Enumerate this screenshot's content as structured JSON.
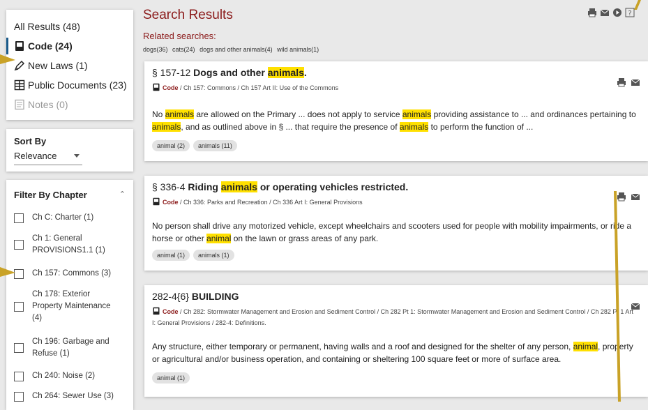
{
  "sidebar": {
    "results": [
      {
        "label": "All Results (48)",
        "icon": "none"
      },
      {
        "label": "Code (24)",
        "icon": "book-icon"
      },
      {
        "label": "New Laws (1)",
        "icon": "pen-icon"
      },
      {
        "label": "Public Documents (23)",
        "icon": "grid-icon"
      },
      {
        "label": "Notes (0)",
        "icon": "notes-icon"
      }
    ],
    "sort_label": "Sort By",
    "sort_value": "Relevance",
    "filter_title": "Filter By Chapter",
    "filters": [
      "Ch C: Charter (1)",
      "Ch 1: General PROVISIONS1.1 (1)",
      "Ch 157: Commons (3)",
      "Ch 178: Exterior Property Maintenance (4)",
      "Ch 196: Garbage and Refuse (1)",
      "Ch 240: Noise (2)",
      "Ch 264: Sewer Use (3)"
    ]
  },
  "header": {
    "title": "Search Results",
    "related_label": "Related searches:",
    "related": [
      "dogs(36)",
      "cats(24)",
      "dogs and other animals(4)",
      "wild animals(1)"
    ]
  },
  "results": [
    {
      "num": "§ 157-12",
      "title_pre": "Dogs and other ",
      "title_hl": "animals",
      "title_post": ".",
      "code": "Code",
      "path": " / Ch 157: Commons / Ch 157 Art II: Use of the Commons",
      "tags": [
        "animal (2)",
        "animals (11)"
      ]
    },
    {
      "num": "§ 336-4",
      "title_pre": "Riding ",
      "title_hl": "animals",
      "title_post": " or operating vehicles restricted.",
      "code": "Code",
      "path": " / Ch 336: Parks and Recreation / Ch 336 Art I: General Provisions",
      "snippet": "No person shall drive any motorized vehicle, except wheelchairs and scooters used for people with mobility impairments, or ride a horse or other",
      "snippet_hl": "animal",
      "snippet_post": " on the lawn or grass areas of any park.",
      "tags": [
        "animal (1)",
        "animals (1)"
      ]
    },
    {
      "num": "282-4{6}",
      "title_pre": "BUILDING",
      "code": "Code",
      "path": " / Ch 282: Stormwater Management and Erosion and Sediment Control / Ch 282 Pt 1: Stormwater Management and Erosion and Sediment Control / Ch 282 Pt 1 Art I: General Provisions / 282-4: Definitions.",
      "snippet": "Any structure, either temporary or permanent, having walls and a roof and designed for the shelter of any person,",
      "snippet_hl": "animal",
      "snippet_post": ", property or agricultural and/or business operation, and containing or sheltering 100 square feet or more of surface area.",
      "tags": [
        "animal (1)"
      ]
    }
  ],
  "snippet1": {
    "a": "No ",
    "h1": "animals",
    "b": " are allowed on the Primary ... does not apply to service ",
    "h2": "animals",
    "c": " providing assistance to ... and ordinances pertaining to ",
    "h3": "animals",
    "d": ", and as outlined above in § ... that require the presence of ",
    "h4": "animals",
    "e": " to perform the function of ..."
  },
  "colors": {
    "accent": "#8b1a1a",
    "highlight": "#ffe000",
    "callout": "#c9a227"
  }
}
